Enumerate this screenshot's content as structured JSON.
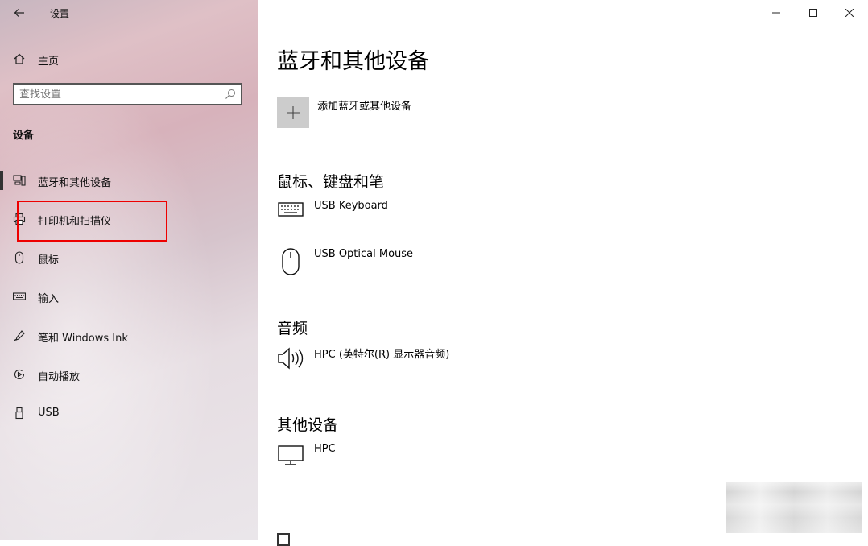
{
  "window": {
    "title": "设置"
  },
  "sidebar": {
    "home_label": "主页",
    "search_placeholder": "查找设置",
    "section_heading": "设备",
    "items": [
      {
        "label": "蓝牙和其他设备",
        "icon": "bluetooth-devices-icon"
      },
      {
        "label": "打印机和扫描仪",
        "icon": "printer-icon"
      },
      {
        "label": "鼠标",
        "icon": "mouse-icon"
      },
      {
        "label": "输入",
        "icon": "keyboard-icon"
      },
      {
        "label": "笔和 Windows Ink",
        "icon": "pen-icon"
      },
      {
        "label": "自动播放",
        "icon": "autoplay-icon"
      },
      {
        "label": "USB",
        "icon": "usb-icon"
      }
    ],
    "active_item": "蓝牙和其他设备",
    "highlighted_item": "打印机和扫描仪",
    "highlight_color": "#e00000"
  },
  "main": {
    "page_title": "蓝牙和其他设备",
    "add_device_label": "添加蓝牙或其他设备",
    "groups": [
      {
        "title": "鼠标、键盘和笔",
        "devices": [
          {
            "name": "USB Keyboard",
            "icon": "keyboard-device-icon"
          },
          {
            "name": "USB Optical Mouse",
            "icon": "mouse-device-icon"
          }
        ]
      },
      {
        "title": "音频",
        "devices": [
          {
            "name": "HPC (英特尔(R) 显示器音频)",
            "icon": "speaker-icon"
          }
        ]
      },
      {
        "title": "其他设备",
        "devices": [
          {
            "name": "HPC",
            "icon": "monitor-icon"
          }
        ]
      }
    ]
  },
  "colors": {
    "sidebar_tint": "#d9c0c8",
    "add_button_bg": "#cccccc"
  }
}
